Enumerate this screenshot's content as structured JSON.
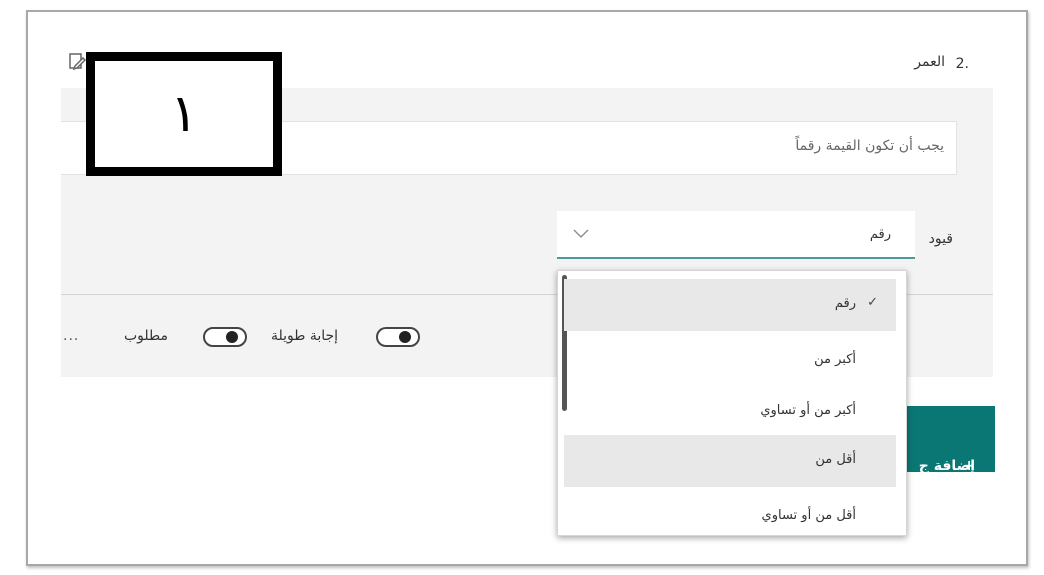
{
  "question": {
    "number": "2.",
    "title": "العمر",
    "answer_placeholder": "يجب أن تكون القيمة رقماً"
  },
  "step_badge": "١",
  "restrictions": {
    "label": "قيود",
    "selected": "رقم",
    "options": [
      {
        "label": "رقم",
        "checked": true,
        "highlighted": true
      },
      {
        "label": "أكبر من",
        "checked": false,
        "highlighted": false
      },
      {
        "label": "أكبر من أو تساوي",
        "checked": false,
        "highlighted": false
      },
      {
        "label": "أقل من",
        "checked": false,
        "highlighted": true
      },
      {
        "label": "أقل من أو تساوي",
        "checked": false,
        "highlighted": false
      }
    ]
  },
  "toggles": {
    "long_answer": {
      "label": "إجابة طويلة",
      "on": true
    },
    "required": {
      "label": "مطلوب",
      "on": true
    }
  },
  "more_label": "...",
  "add_button": {
    "label": "إضافة ج"
  },
  "icons": {
    "edit": "edit-question-icon",
    "chevron": "chevron-down-icon",
    "check": "checkmark-icon",
    "plus": "plus-icon",
    "more": "more-options-icon"
  },
  "colors": {
    "accent": "#0b7774",
    "select_underline": "#4e9a98",
    "highlight": "#e8e8e8"
  }
}
